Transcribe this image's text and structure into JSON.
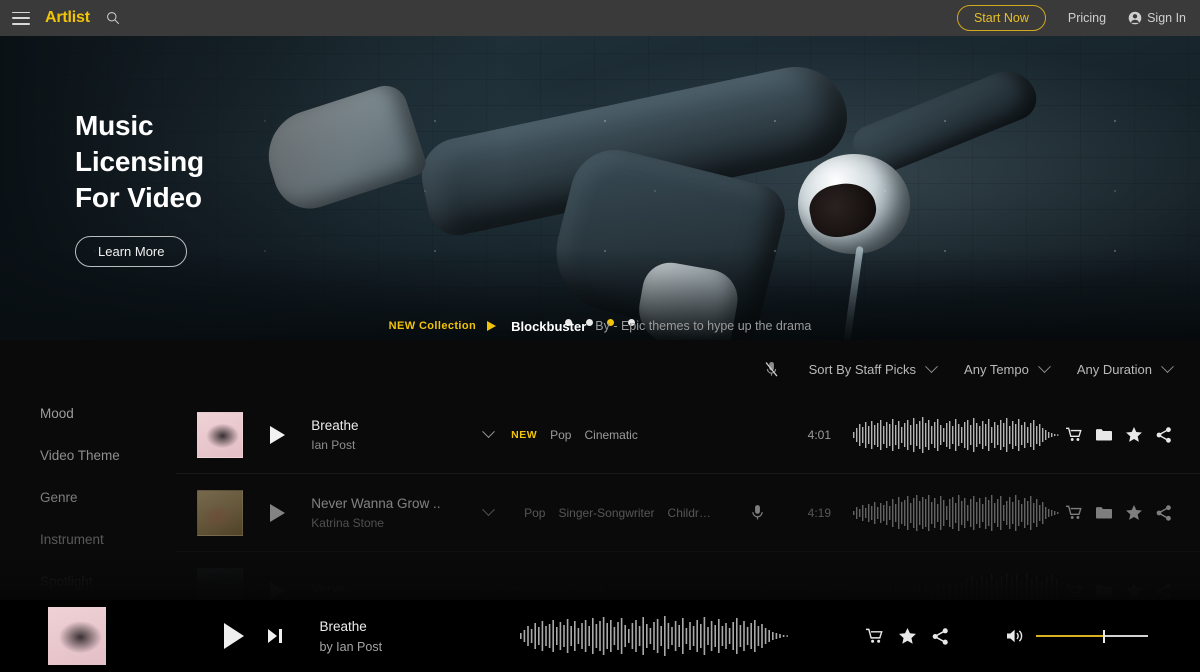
{
  "header": {
    "logo": "Artlist",
    "menu_icon": "hamburger-icon",
    "search_icon": "search-icon",
    "start_now": "Start Now",
    "pricing": "Pricing",
    "sign_in": "Sign In"
  },
  "hero": {
    "title_line1": "Music",
    "title_line2": "Licensing",
    "title_line3": "For Video",
    "cta": "Learn More",
    "carousel": {
      "count": 4,
      "active_index": 2,
      "active_color": "#f2c409"
    }
  },
  "collection": {
    "new_label": "NEW Collection",
    "name": "Blockbuster",
    "description": "By - Epic themes to hype up the drama"
  },
  "filters": {
    "mic_icon": "microphone-off-icon",
    "items": [
      {
        "label": "Sort By Staff Picks"
      },
      {
        "label": "Any Tempo"
      },
      {
        "label": "Any Duration"
      }
    ]
  },
  "sidebar": {
    "items": [
      {
        "label": "Mood"
      },
      {
        "label": "Video Theme"
      },
      {
        "label": "Genre"
      },
      {
        "label": "Instrument"
      },
      {
        "label": "Spotlight"
      }
    ]
  },
  "tracks": [
    {
      "title": "Breathe",
      "artist": "Ian Post",
      "badge": "NEW",
      "tags": [
        "Pop",
        "Cinematic"
      ],
      "duration": "4:01",
      "has_vocals": false,
      "art": "pink"
    },
    {
      "title": "Never Wanna Grow ..",
      "artist": "Katrina Stone",
      "badge": "",
      "tags": [
        "Pop",
        "Singer-Songwriter",
        "Childre..."
      ],
      "duration": "4:19",
      "has_vocals": true,
      "art": "gold"
    },
    {
      "title": "Verve",
      "artist": "",
      "badge": "",
      "tags": [
        "Cinematic",
        "Rock"
      ],
      "duration": "3:31",
      "has_vocals": false,
      "art": "dim"
    }
  ],
  "track_actions": {
    "cart": "cart-icon",
    "folder": "folder-icon",
    "star": "star-icon",
    "share": "share-icon"
  },
  "player": {
    "title": "Breathe",
    "artist": "by Ian Post",
    "play_icon": "play-icon",
    "next_icon": "next-track-icon",
    "volume_icon": "volume-icon",
    "volume_percent": 60,
    "volume_fill_color": "#d8b021"
  },
  "colors": {
    "accent": "#f2c409",
    "header_bg": "#3a3a3a",
    "page_bg": "#0a0a0a",
    "player_bg": "#000000"
  }
}
